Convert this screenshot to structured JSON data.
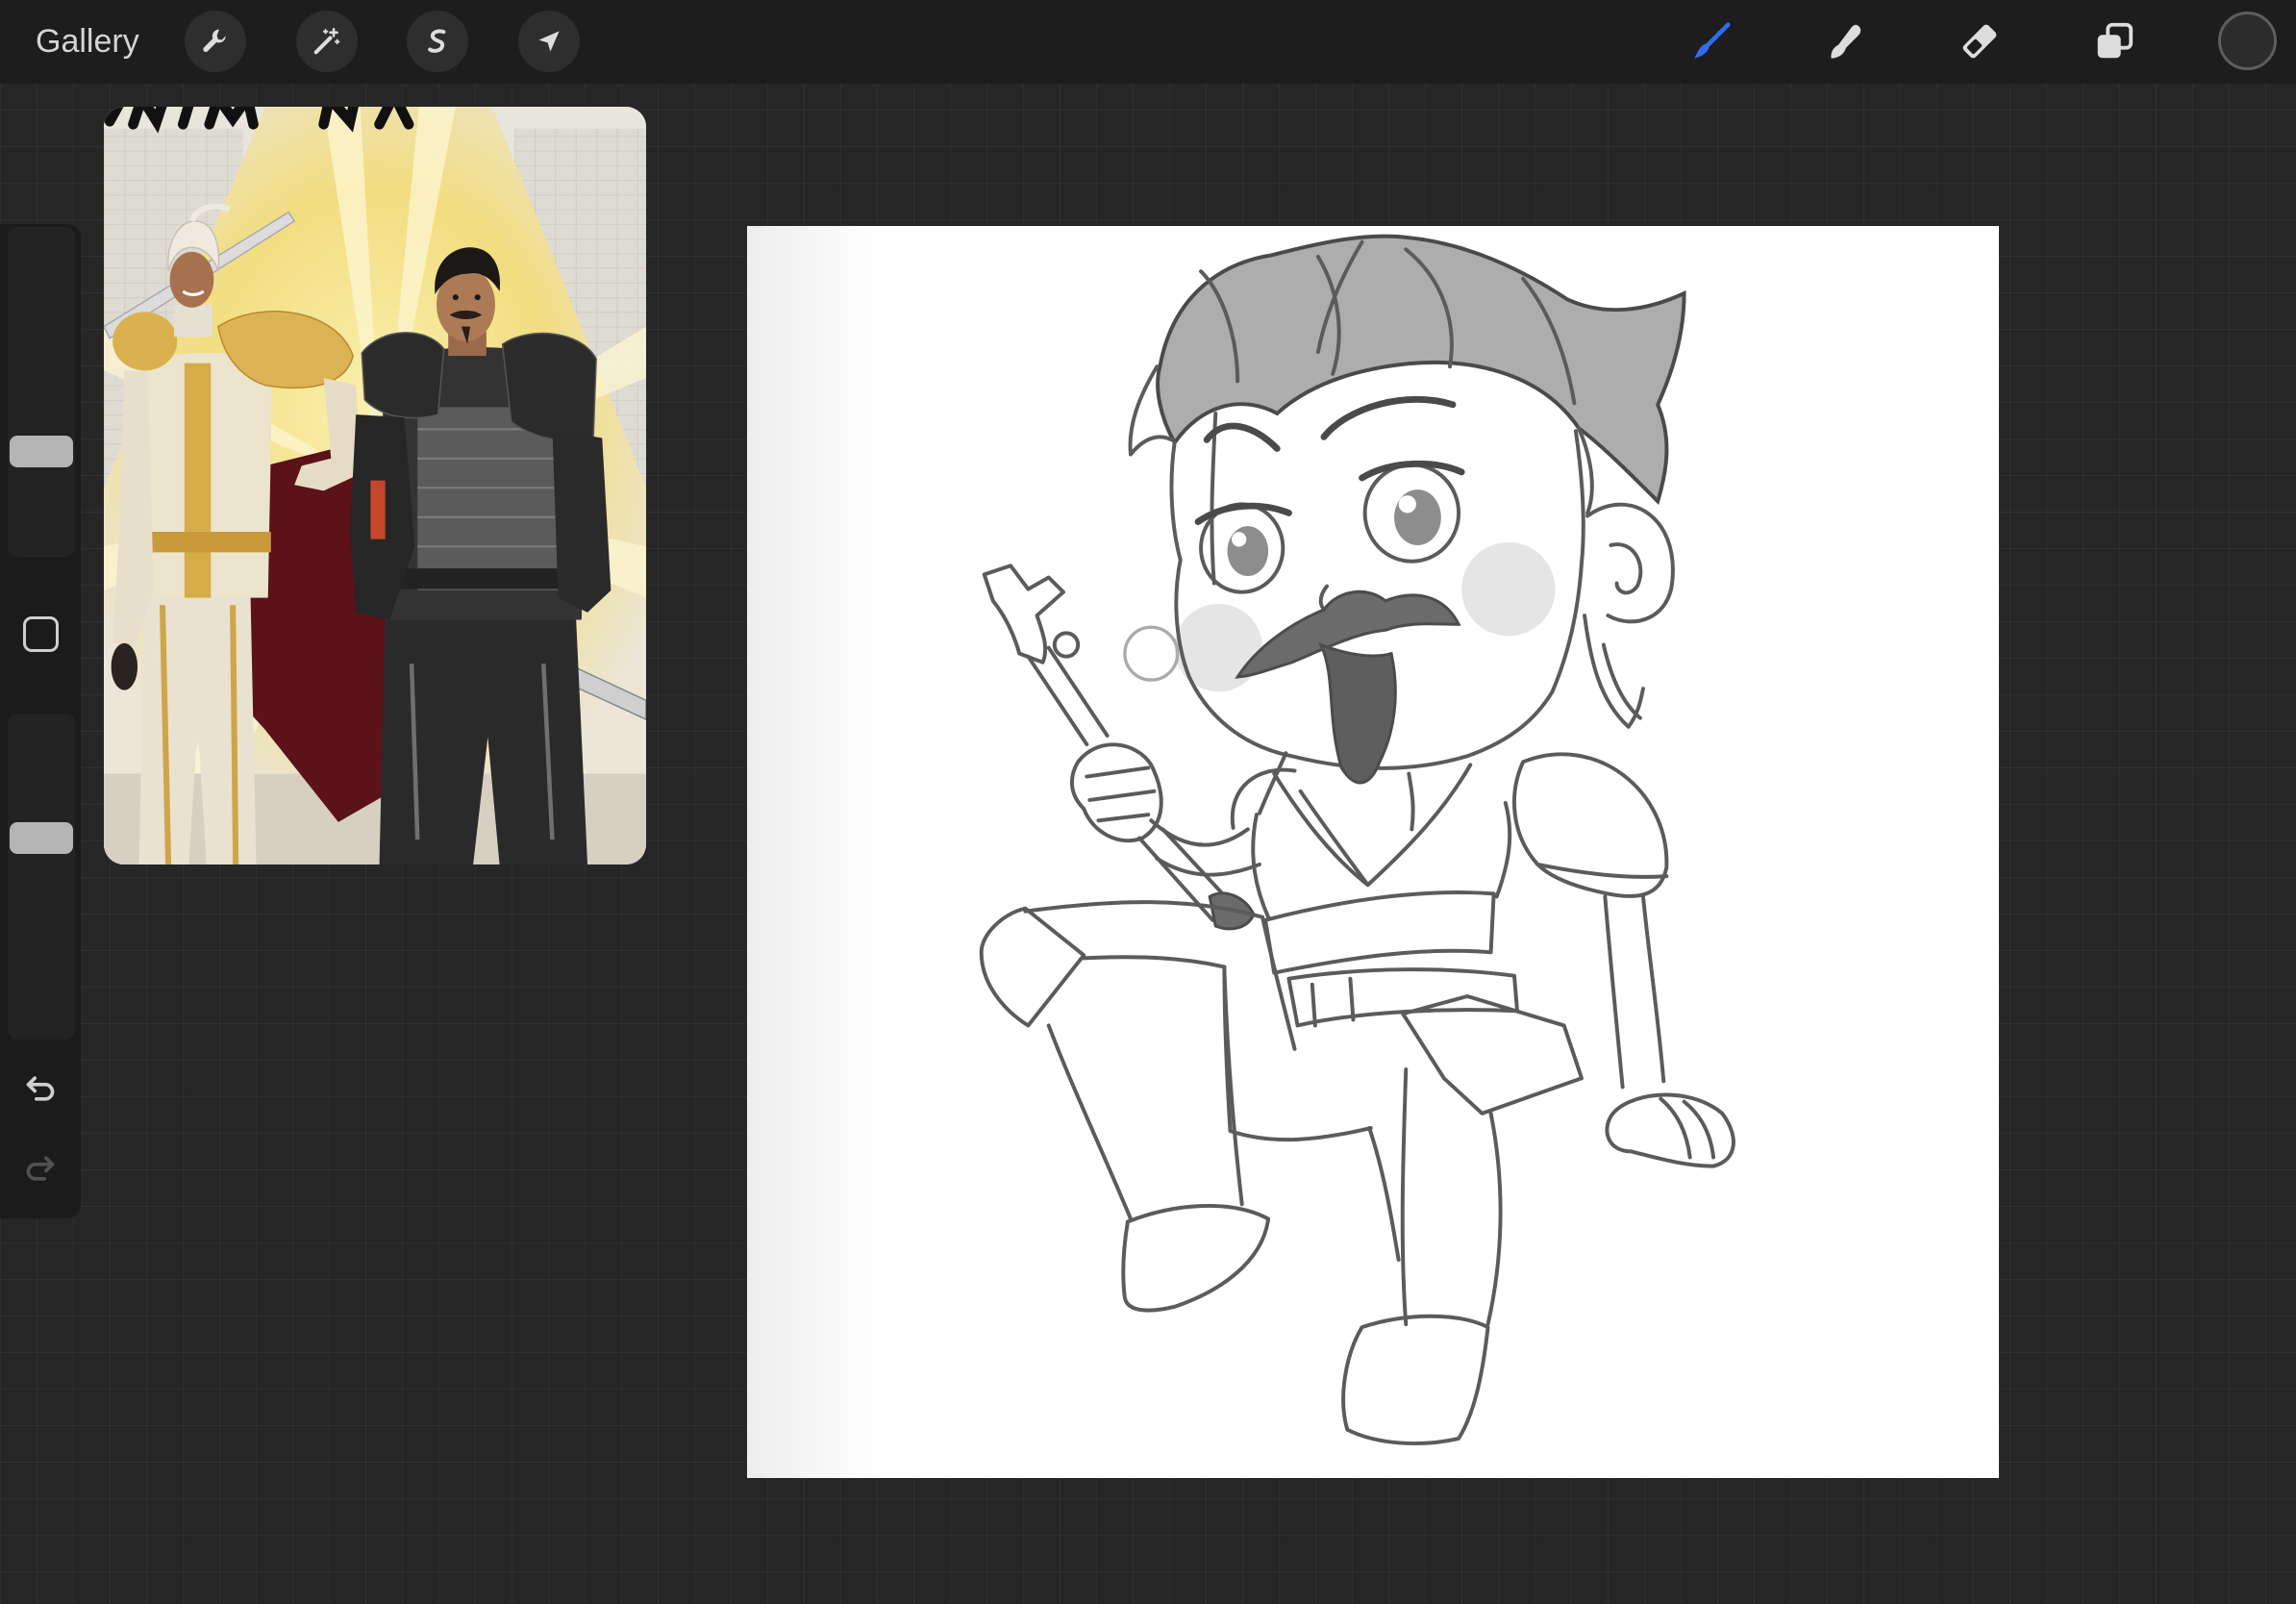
{
  "top_bar": {
    "gallery_label": "Gallery",
    "left_tools": [
      "wrench-icon",
      "magic-wand-icon",
      "selection-icon",
      "transform-arrow-icon"
    ],
    "right_tools": [
      "brush-icon",
      "smudge-icon",
      "eraser-icon",
      "layers-icon"
    ],
    "active_tool": "brush-icon",
    "current_color": "#2c2c2c"
  },
  "sidebar": {
    "brush_size": 0.3,
    "opacity": 0.63,
    "undo_enabled": true,
    "redo_enabled": false,
    "icons": [
      "modify-square-icon",
      "undo-icon",
      "redo-icon"
    ]
  },
  "colors": {
    "accent": "#2f6ef0",
    "icon": "#dddddd"
  }
}
